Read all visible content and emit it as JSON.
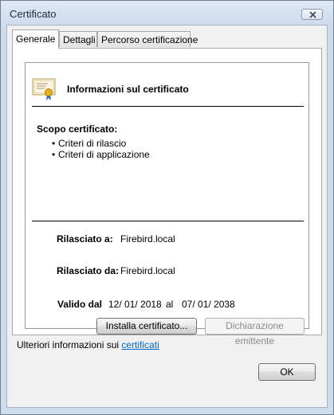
{
  "window": {
    "title": "Certificato"
  },
  "tabs": [
    {
      "label": "Generale",
      "active": true
    },
    {
      "label": "Dettagli",
      "active": false
    },
    {
      "label": "Percorso certificazione",
      "active": false
    }
  ],
  "info": {
    "title": "Informazioni sul certificato",
    "scope_title": "Scopo certificato:",
    "scope_items": [
      "Criteri di rilascio",
      "Criteri di applicazione"
    ],
    "issued_to_label": "Rilasciato a:",
    "issued_to_value": "Firebird.local",
    "issued_by_label": "Rilasciato da:",
    "issued_by_value": "Firebird.local",
    "valid_from_label": "Valido dal",
    "valid_from": "12/ 01/ 2018",
    "valid_sep": "al",
    "valid_to": "07/ 01/ 2038"
  },
  "buttons": {
    "install": "Installa certificato...",
    "issuer_statement": "Dichiarazione emittente",
    "ok": "OK"
  },
  "more_info": {
    "text": "Ulteriori informazioni sui",
    "link": "certificati"
  },
  "colors": {
    "link": "#0066cc",
    "window_frame": "#cfdcec"
  }
}
